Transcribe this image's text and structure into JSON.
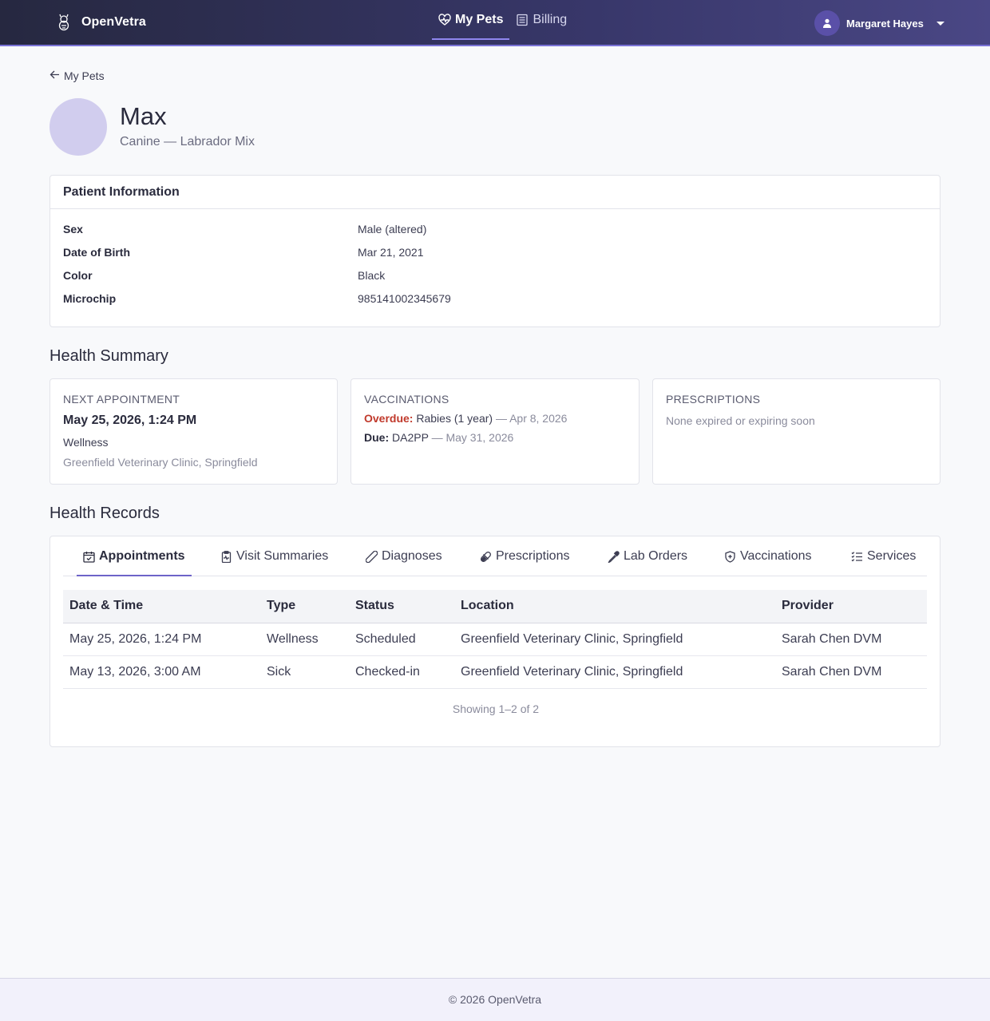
{
  "header": {
    "brand": "OpenVetra",
    "nav": [
      {
        "label": "My Pets",
        "active": true,
        "icon": "heart-pulse-icon"
      },
      {
        "label": "Billing",
        "active": false,
        "icon": "receipt-icon"
      }
    ],
    "user_name": "Margaret Hayes"
  },
  "back_link": "My Pets",
  "pet": {
    "name": "Max",
    "subtitle": "Canine — Labrador Mix"
  },
  "patient_info": {
    "title": "Patient Information",
    "rows": [
      {
        "label": "Sex",
        "value": "Male (altered)"
      },
      {
        "label": "Date of Birth",
        "value": "Mar 21, 2021"
      },
      {
        "label": "Color",
        "value": "Black"
      },
      {
        "label": "Microchip",
        "value": "985141002345679"
      }
    ]
  },
  "health_summary": {
    "title": "Health Summary",
    "next_appointment": {
      "label": "NEXT APPOINTMENT",
      "datetime": "May 25, 2026, 1:24 PM",
      "type": "Wellness",
      "location": "Greenfield Veterinary Clinic, Springfield"
    },
    "vaccinations": {
      "label": "VACCINATIONS",
      "overdue_label": "Overdue:",
      "overdue_name": "Rabies (1 year)",
      "overdue_date": "— Apr 8, 2026",
      "due_label": "Due:",
      "due_name": "DA2PP",
      "due_date": "— May 31, 2026"
    },
    "prescriptions": {
      "label": "PRESCRIPTIONS",
      "text": "None expired or expiring soon"
    }
  },
  "health_records": {
    "title": "Health Records",
    "tabs": [
      {
        "label": "Appointments",
        "icon": "calendar-check-icon",
        "active": true
      },
      {
        "label": "Visit Summaries",
        "icon": "clipboard-pulse-icon",
        "active": false
      },
      {
        "label": "Diagnoses",
        "icon": "bandage-icon",
        "active": false
      },
      {
        "label": "Prescriptions",
        "icon": "capsule-icon",
        "active": false
      },
      {
        "label": "Lab Orders",
        "icon": "eyedropper-icon",
        "active": false
      },
      {
        "label": "Vaccinations",
        "icon": "shield-plus-icon",
        "active": false
      },
      {
        "label": "Services",
        "icon": "list-check-icon",
        "active": false
      }
    ],
    "columns": [
      "Date & Time",
      "Type",
      "Status",
      "Location",
      "Provider"
    ],
    "rows": [
      [
        "May 25, 2026, 1:24 PM",
        "Wellness",
        "Scheduled",
        "Greenfield Veterinary Clinic, Springfield",
        "Sarah Chen DVM"
      ],
      [
        "May 13, 2026, 3:00 AM",
        "Sick",
        "Checked-in",
        "Greenfield Veterinary Clinic, Springfield",
        "Sarah Chen DVM"
      ]
    ],
    "showing": "Showing 1–2 of 2"
  },
  "footer": "© 2026 OpenVetra"
}
